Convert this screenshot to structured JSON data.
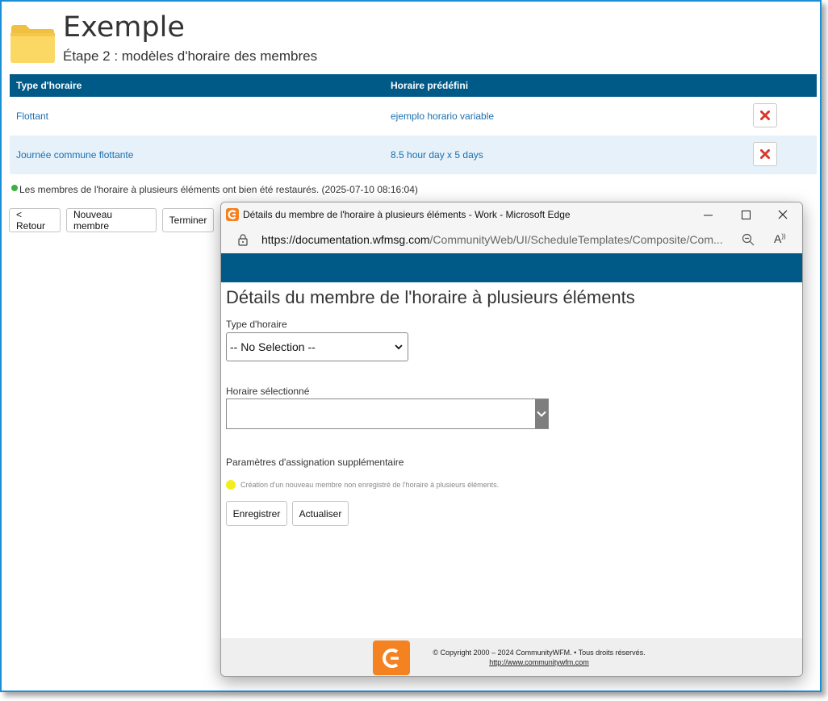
{
  "page": {
    "title": "Exemple",
    "subtitle": "Étape 2 : modèles d'horaire des membres"
  },
  "grid": {
    "headers": [
      "Type d'horaire",
      "Horaire prédéfini"
    ],
    "rows": [
      {
        "type": "Flottant",
        "schedule": "ejemplo horario variable"
      },
      {
        "type": "Journée commune flottante",
        "schedule": "8.5 hour day x 5 days"
      }
    ]
  },
  "status": {
    "message": "Les membres de l'horaire à plusieurs éléments ont bien été restaurés. (2025-07-10 08:16:04)"
  },
  "actions": {
    "back": "< Retour",
    "new_member": "Nouveau membre",
    "finish": "Terminer"
  },
  "popup": {
    "window_title": "Détails du membre de l'horaire à plusieurs éléments - Work - Microsoft Edge",
    "url_domain": "https://documentation.wfmsg.com",
    "url_path": "/CommunityWeb/UI/ScheduleTemplates/Composite/Com...",
    "heading": "Détails du membre de l'horaire à plusieurs éléments",
    "type_label": "Type d'horaire",
    "type_value": "-- No Selection --",
    "selected_label": "Horaire sélectionné",
    "selected_value": "",
    "extra_params_label": "Paramètres d'assignation supplémentaire",
    "hint": "Création d'un nouveau membre non enregistré de l'horaire à plusieurs éléments.",
    "save": "Enregistrer",
    "refresh": "Actualiser",
    "copyright": "© Copyright 2000 – 2024 CommunityWFM. • Tous droits réservés.",
    "footer_link": "http://www.communitywfm.com"
  },
  "colors": {
    "header_blue": "#005a87",
    "link_blue": "#1a6fb0",
    "delete_red": "#d9372b",
    "brand_orange": "#f58220"
  },
  "icons": [
    "folder-icon",
    "delete-icon",
    "success-dot-icon",
    "edge-browser-icon",
    "minimize-icon",
    "maximize-icon",
    "close-icon",
    "lock-icon",
    "zoom-icon",
    "read-aloud-icon",
    "chevron-down-icon",
    "communitywfm-logo-icon"
  ]
}
